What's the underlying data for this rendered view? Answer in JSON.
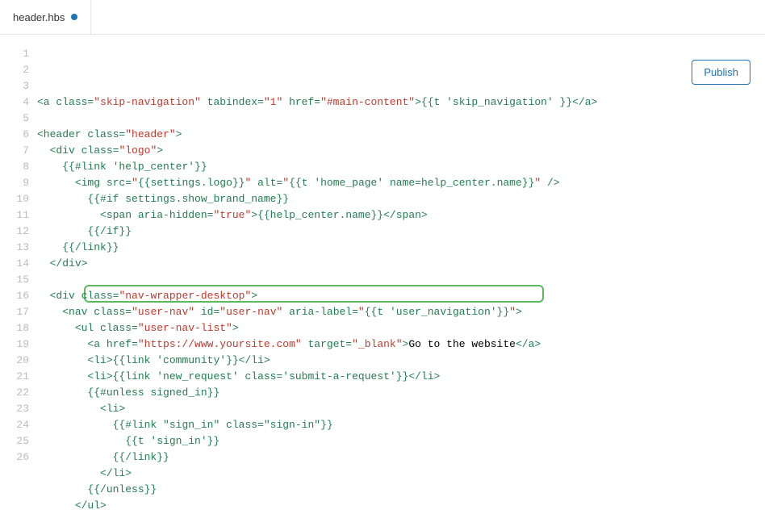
{
  "tab": {
    "filename": "header.hbs",
    "modified": true
  },
  "publish_label": "Publish",
  "highlight_line_index": 15,
  "code_lines": [
    {
      "n": 1,
      "indent": 0,
      "tokens": [
        {
          "t": "<a",
          "c": "tag"
        },
        {
          "t": " class=",
          "c": "attr"
        },
        {
          "t": "\"skip-navigation\"",
          "c": "str"
        },
        {
          "t": " tabindex=",
          "c": "attr"
        },
        {
          "t": "\"1\"",
          "c": "str"
        },
        {
          "t": " href=",
          "c": "attr"
        },
        {
          "t": "\"#main-content\"",
          "c": "str"
        },
        {
          "t": ">",
          "c": "tag"
        },
        {
          "t": "{{t 'skip_navigation' }}",
          "c": "hbs"
        },
        {
          "t": "</a>",
          "c": "tag"
        }
      ]
    },
    {
      "n": 2,
      "indent": 0,
      "tokens": []
    },
    {
      "n": 3,
      "indent": 0,
      "tokens": [
        {
          "t": "<header",
          "c": "tag"
        },
        {
          "t": " class=",
          "c": "attr"
        },
        {
          "t": "\"header\"",
          "c": "str"
        },
        {
          "t": ">",
          "c": "tag"
        }
      ]
    },
    {
      "n": 4,
      "indent": 1,
      "tokens": [
        {
          "t": "<div",
          "c": "tag"
        },
        {
          "t": " class=",
          "c": "attr"
        },
        {
          "t": "\"logo\"",
          "c": "str"
        },
        {
          "t": ">",
          "c": "tag"
        }
      ]
    },
    {
      "n": 5,
      "indent": 2,
      "tokens": [
        {
          "t": "{{#link 'help_center'}}",
          "c": "hbs"
        }
      ]
    },
    {
      "n": 6,
      "indent": 3,
      "tokens": [
        {
          "t": "<img",
          "c": "tag"
        },
        {
          "t": " src=",
          "c": "attr"
        },
        {
          "t": "\"",
          "c": "str"
        },
        {
          "t": "{{settings.logo}}",
          "c": "hbs"
        },
        {
          "t": "\"",
          "c": "str"
        },
        {
          "t": " alt=",
          "c": "attr"
        },
        {
          "t": "\"",
          "c": "str"
        },
        {
          "t": "{{t 'home_page' name=help_center.name}}",
          "c": "hbs"
        },
        {
          "t": "\"",
          "c": "str"
        },
        {
          "t": " />",
          "c": "tag"
        }
      ]
    },
    {
      "n": 7,
      "indent": 4,
      "tokens": [
        {
          "t": "{{#if settings.show_brand_name}}",
          "c": "hbs"
        }
      ]
    },
    {
      "n": 8,
      "indent": 5,
      "tokens": [
        {
          "t": "<span",
          "c": "tag"
        },
        {
          "t": " aria-hidden=",
          "c": "attr"
        },
        {
          "t": "\"true\"",
          "c": "str"
        },
        {
          "t": ">",
          "c": "tag"
        },
        {
          "t": "{{help_center.name}}",
          "c": "hbs"
        },
        {
          "t": "</span>",
          "c": "tag"
        }
      ]
    },
    {
      "n": 9,
      "indent": 4,
      "tokens": [
        {
          "t": "{{/if}}",
          "c": "hbs"
        }
      ]
    },
    {
      "n": 10,
      "indent": 2,
      "tokens": [
        {
          "t": "{{/link}}",
          "c": "hbs"
        }
      ]
    },
    {
      "n": 11,
      "indent": 1,
      "tokens": [
        {
          "t": "</div>",
          "c": "tag"
        }
      ]
    },
    {
      "n": 12,
      "indent": 0,
      "tokens": []
    },
    {
      "n": 13,
      "indent": 1,
      "tokens": [
        {
          "t": "<div",
          "c": "tag"
        },
        {
          "t": " class=",
          "c": "attr"
        },
        {
          "t": "\"nav-wrapper-desktop\"",
          "c": "str"
        },
        {
          "t": ">",
          "c": "tag"
        }
      ]
    },
    {
      "n": 14,
      "indent": 2,
      "tokens": [
        {
          "t": "<nav",
          "c": "tag"
        },
        {
          "t": " class=",
          "c": "attr"
        },
        {
          "t": "\"user-nav\"",
          "c": "str"
        },
        {
          "t": " id=",
          "c": "attr"
        },
        {
          "t": "\"user-nav\"",
          "c": "str"
        },
        {
          "t": " aria-label=",
          "c": "attr"
        },
        {
          "t": "\"",
          "c": "str"
        },
        {
          "t": "{{t 'user_navigation'}}",
          "c": "hbs"
        },
        {
          "t": "\"",
          "c": "str"
        },
        {
          "t": ">",
          "c": "tag"
        }
      ]
    },
    {
      "n": 15,
      "indent": 3,
      "tokens": [
        {
          "t": "<ul",
          "c": "tag"
        },
        {
          "t": " class=",
          "c": "attr"
        },
        {
          "t": "\"user-nav-list\"",
          "c": "str"
        },
        {
          "t": ">",
          "c": "tag"
        }
      ]
    },
    {
      "n": 16,
      "indent": 4,
      "tokens": [
        {
          "t": "<a",
          "c": "tag"
        },
        {
          "t": " href=",
          "c": "attr"
        },
        {
          "t": "\"https://www.yoursite.com\"",
          "c": "str"
        },
        {
          "t": " target=",
          "c": "attr"
        },
        {
          "t": "\"_blank\"",
          "c": "str"
        },
        {
          "t": ">",
          "c": "tag"
        },
        {
          "t": "Go to the website",
          "c": "text"
        },
        {
          "t": "</a>",
          "c": "tag"
        }
      ]
    },
    {
      "n": 17,
      "indent": 4,
      "tokens": [
        {
          "t": "<li>",
          "c": "tag"
        },
        {
          "t": "{{link 'community'}}",
          "c": "hbs"
        },
        {
          "t": "</li>",
          "c": "tag"
        }
      ]
    },
    {
      "n": 18,
      "indent": 4,
      "tokens": [
        {
          "t": "<li>",
          "c": "tag"
        },
        {
          "t": "{{link 'new_request' class='submit-a-request'}}",
          "c": "hbs"
        },
        {
          "t": "</li>",
          "c": "tag"
        }
      ]
    },
    {
      "n": 19,
      "indent": 4,
      "tokens": [
        {
          "t": "{{#unless signed_in}}",
          "c": "hbs"
        }
      ]
    },
    {
      "n": 20,
      "indent": 5,
      "tokens": [
        {
          "t": "<li>",
          "c": "tag"
        }
      ]
    },
    {
      "n": 21,
      "indent": 6,
      "tokens": [
        {
          "t": "{{#link \"sign_in\" class=\"sign-in\"}}",
          "c": "hbs"
        }
      ]
    },
    {
      "n": 22,
      "indent": 7,
      "tokens": [
        {
          "t": "{{t 'sign_in'}}",
          "c": "hbs"
        }
      ]
    },
    {
      "n": 23,
      "indent": 6,
      "tokens": [
        {
          "t": "{{/link}}",
          "c": "hbs"
        }
      ]
    },
    {
      "n": 24,
      "indent": 5,
      "tokens": [
        {
          "t": "</li>",
          "c": "tag"
        }
      ]
    },
    {
      "n": 25,
      "indent": 4,
      "tokens": [
        {
          "t": "{{/unless}}",
          "c": "hbs"
        }
      ]
    },
    {
      "n": 26,
      "indent": 3,
      "tokens": [
        {
          "t": "</ul>",
          "c": "tag"
        }
      ]
    }
  ]
}
